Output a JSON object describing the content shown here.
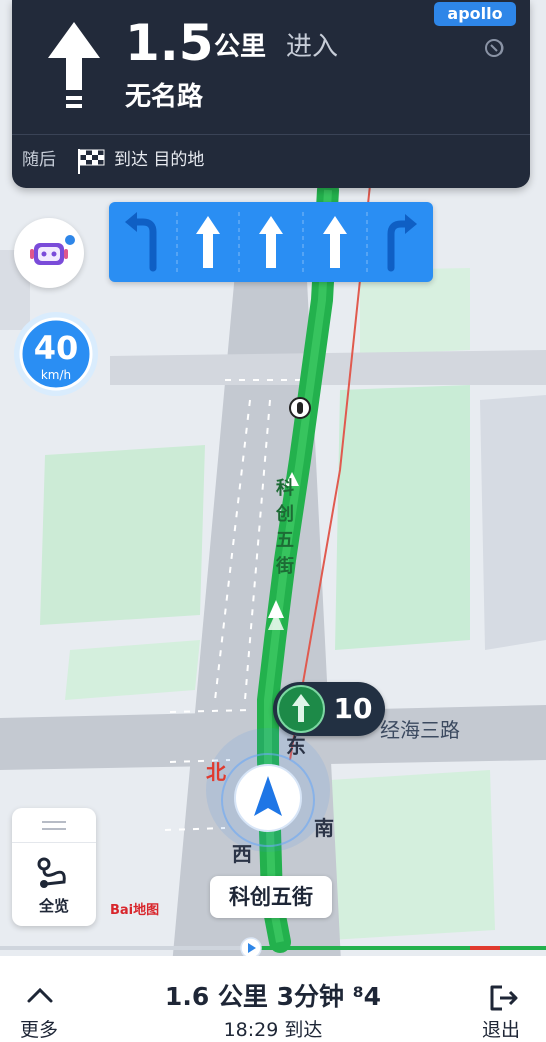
{
  "maneuver": {
    "distance_value": "1.5",
    "distance_unit": "公里",
    "action": "进入",
    "road_name": "无名路",
    "then_label": "随后",
    "arrive_label": "到达 目的地"
  },
  "brand": {
    "logo_text": "apollo"
  },
  "speed_limit": {
    "value": "40",
    "unit": "km/h"
  },
  "lane_count_pill": {
    "value": "10"
  },
  "map_labels": {
    "road_vertical": "科创五街",
    "road_right": "经海三路",
    "compass_east": "东",
    "compass_north": "北",
    "compass_south": "南",
    "compass_west": "西",
    "current_road": "科创五街"
  },
  "overview": {
    "label": "全览"
  },
  "baidu_logo": {
    "text": "Bai地图"
  },
  "bottom_bar": {
    "more_label": "更多",
    "summary": "1.6 公里 3分钟 ⁸4",
    "eta": "18:29 到达",
    "exit_label": "退出"
  },
  "colors": {
    "route": "#23b14d",
    "panel": "#222a3a",
    "lane_bar": "#2a8ef3",
    "accent": "#2e86e8"
  }
}
